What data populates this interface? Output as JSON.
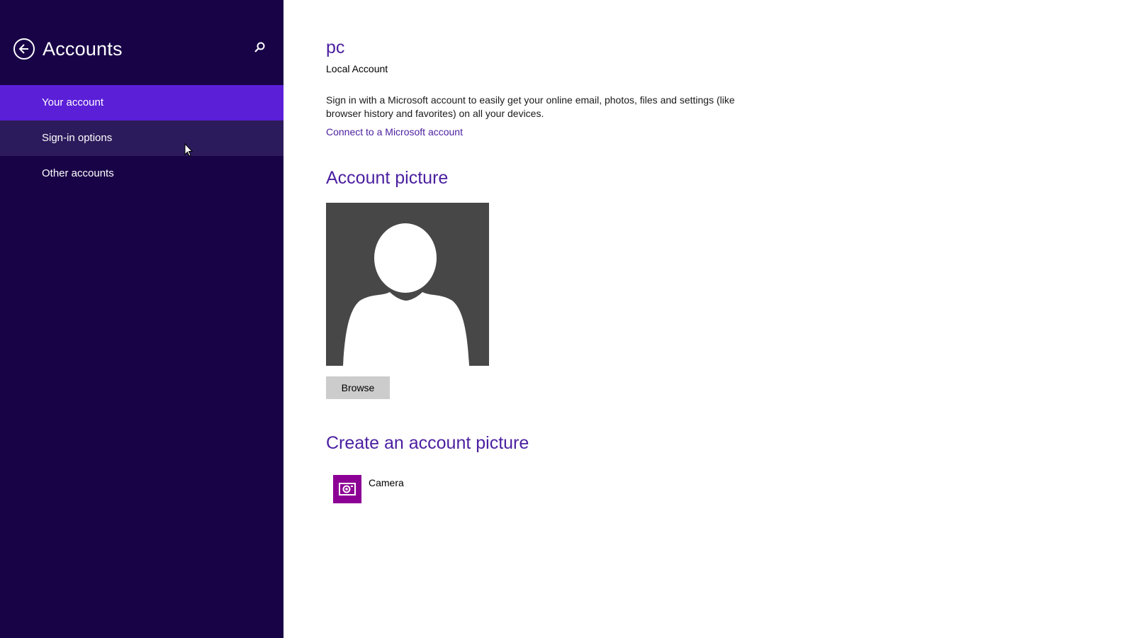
{
  "sidebar": {
    "title": "Accounts",
    "back_icon": "back-arrow-icon",
    "search_icon": "search-icon",
    "items": [
      {
        "label": "Your account",
        "state": "selected"
      },
      {
        "label": "Sign-in options",
        "state": "hover"
      },
      {
        "label": "Other accounts",
        "state": "normal"
      }
    ]
  },
  "main": {
    "user_name": "pc",
    "account_type": "Local Account",
    "description": "Sign in with a Microsoft account to easily get your online email, photos, files and settings (like browser history and favorites) on all your devices.",
    "connect_link": "Connect to a Microsoft account",
    "picture_heading": "Account picture",
    "browse_label": "Browse",
    "create_heading": "Create an account picture",
    "camera_label": "Camera",
    "camera_icon": "camera-icon",
    "placeholder_icon": "user-silhouette-icon"
  },
  "colors": {
    "sidebar_bg": "#180347",
    "selected_bg": "#5b1fd8",
    "hover_bg": "#2c1b5c",
    "accent": "#4b1fa0",
    "camera_tile": "#8c0095",
    "picture_bg": "#474747"
  }
}
